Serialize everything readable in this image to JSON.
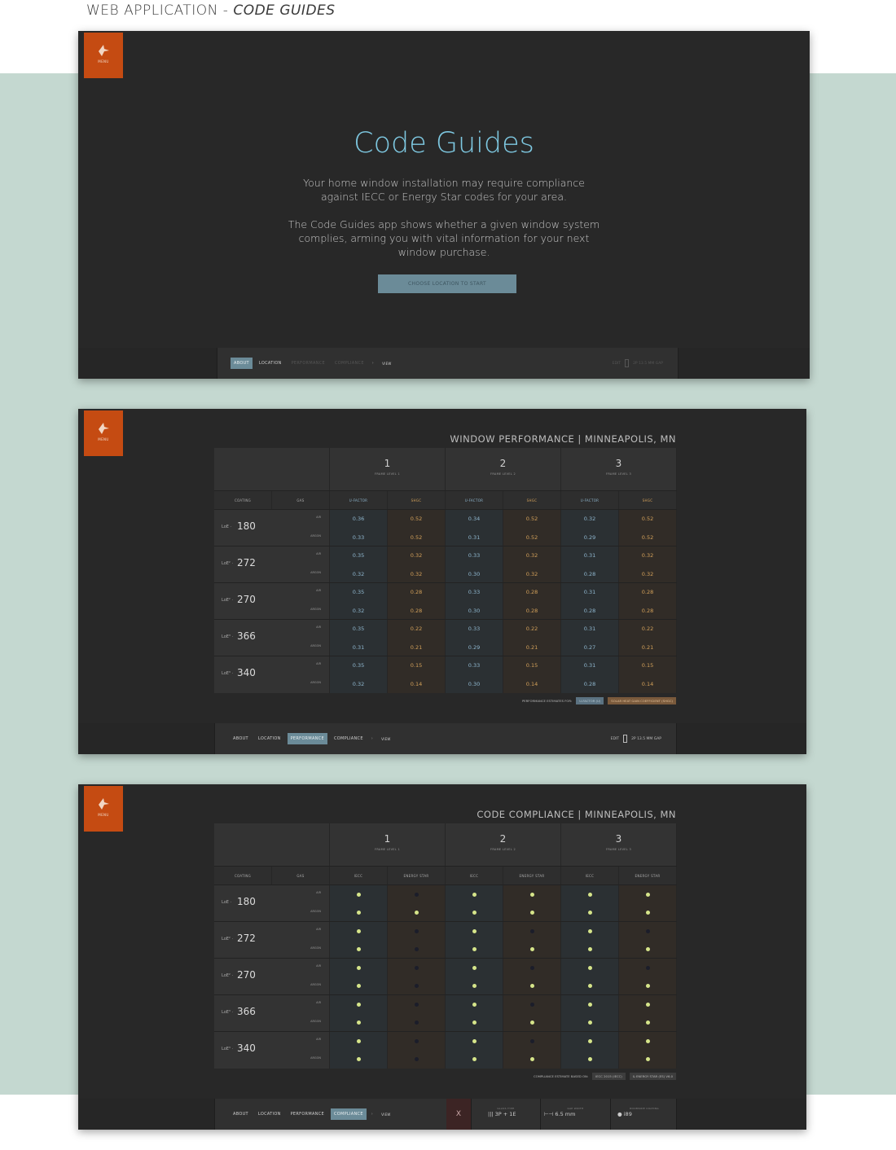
{
  "page_title": {
    "plain": "WEB APPLICATION - ",
    "italic": "CODE GUIDES"
  },
  "menu_label": "MENU",
  "hero": {
    "title": "Code Guides",
    "p1_line1": "Your home window installation may require compliance",
    "p1_line2": "against IECC or Energy Star codes for your area.",
    "p2_line1": "The Code Guides app shows whether a given window system",
    "p2_line2": "complies, arming you with vital information for your next",
    "p2_line3": "window purchase.",
    "cta": "CHOOSE LOCATION TO START"
  },
  "nav": {
    "about": "ABOUT",
    "location": "LOCATION",
    "performance": "PERFORMANCE",
    "compliance": "COMPLIANCE",
    "arrow": "›",
    "view": "VIEW",
    "edit": "EDIT",
    "glass_value": "2P 13.5 MM GAP"
  },
  "performance": {
    "title": "WINDOW PERFORMANCE | MINNEAPOLIS, MN",
    "frames": [
      {
        "num": "1",
        "label": "FRAME LEVEL 1"
      },
      {
        "num": "2",
        "label": "FRAME LEVEL 2"
      },
      {
        "num": "3",
        "label": "FRAME LEVEL 3"
      }
    ],
    "col_coating": "COATING",
    "col_gas": "GAS",
    "col_u": "U-FACTOR",
    "col_s": "SHGC",
    "gas_air": "AIR",
    "gas_argon": "ARGON",
    "rows": [
      {
        "pre": "LoE ·",
        "num": "180",
        "air": [
          "0.36",
          "0.52",
          "0.34",
          "0.52",
          "0.32",
          "0.52"
        ],
        "argon": [
          "0.33",
          "0.52",
          "0.31",
          "0.52",
          "0.29",
          "0.52"
        ]
      },
      {
        "pre": "LoE² ·",
        "num": "272",
        "air": [
          "0.35",
          "0.32",
          "0.33",
          "0.32",
          "0.31",
          "0.32"
        ],
        "argon": [
          "0.32",
          "0.32",
          "0.30",
          "0.32",
          "0.28",
          "0.32"
        ]
      },
      {
        "pre": "LoE² ·",
        "num": "270",
        "air": [
          "0.35",
          "0.28",
          "0.33",
          "0.28",
          "0.31",
          "0.28"
        ],
        "argon": [
          "0.32",
          "0.28",
          "0.30",
          "0.28",
          "0.28",
          "0.28"
        ]
      },
      {
        "pre": "LoE³ ·",
        "num": "366",
        "air": [
          "0.35",
          "0.22",
          "0.33",
          "0.22",
          "0.31",
          "0.22"
        ],
        "argon": [
          "0.31",
          "0.21",
          "0.29",
          "0.21",
          "0.27",
          "0.21"
        ]
      },
      {
        "pre": "LoE³ ·",
        "num": "340",
        "air": [
          "0.35",
          "0.15",
          "0.33",
          "0.15",
          "0.31",
          "0.15"
        ],
        "argon": [
          "0.32",
          "0.14",
          "0.30",
          "0.14",
          "0.28",
          "0.14"
        ]
      }
    ],
    "foot_label": "PERFORMANCE ESTIMATES FOR:",
    "foot_u": "U-FACTOR (U)",
    "foot_s": "SOLAR HEAT GAIN COEFFICIENT (SHGC)"
  },
  "compliance": {
    "title": "CODE COMPLIANCE | MINNEAPOLIS, MN",
    "col_iecc": "IECC",
    "col_es": "ENERGY STAR",
    "rows_air": [
      [
        true,
        false,
        true,
        true,
        true,
        true
      ],
      [
        true,
        false,
        true,
        false,
        true,
        false
      ],
      [
        true,
        false,
        true,
        false,
        true,
        false
      ],
      [
        true,
        false,
        true,
        false,
        true,
        true
      ],
      [
        true,
        false,
        true,
        false,
        true,
        true
      ]
    ],
    "rows_argon": [
      [
        true,
        true,
        true,
        true,
        true,
        true
      ],
      [
        true,
        false,
        true,
        true,
        true,
        true
      ],
      [
        true,
        false,
        true,
        true,
        true,
        true
      ],
      [
        true,
        false,
        true,
        true,
        true,
        true
      ],
      [
        true,
        false,
        true,
        true,
        true,
        true
      ]
    ],
    "foot_label": "COMPLIANCE ESTIMATE BASED ON:",
    "foot_iecc": "IECC 2015 (IECC)",
    "foot_es": "& ENERGY STAR (ES) V6.0",
    "close": "X",
    "glass_type_label": "GLASS TYPE",
    "glass_type": "3P + 1E",
    "gap_label": "GAP WIDTH",
    "gap": "6.5 mm",
    "roomside_label": "ROOMSIDE COATING",
    "roomside": "i89"
  }
}
